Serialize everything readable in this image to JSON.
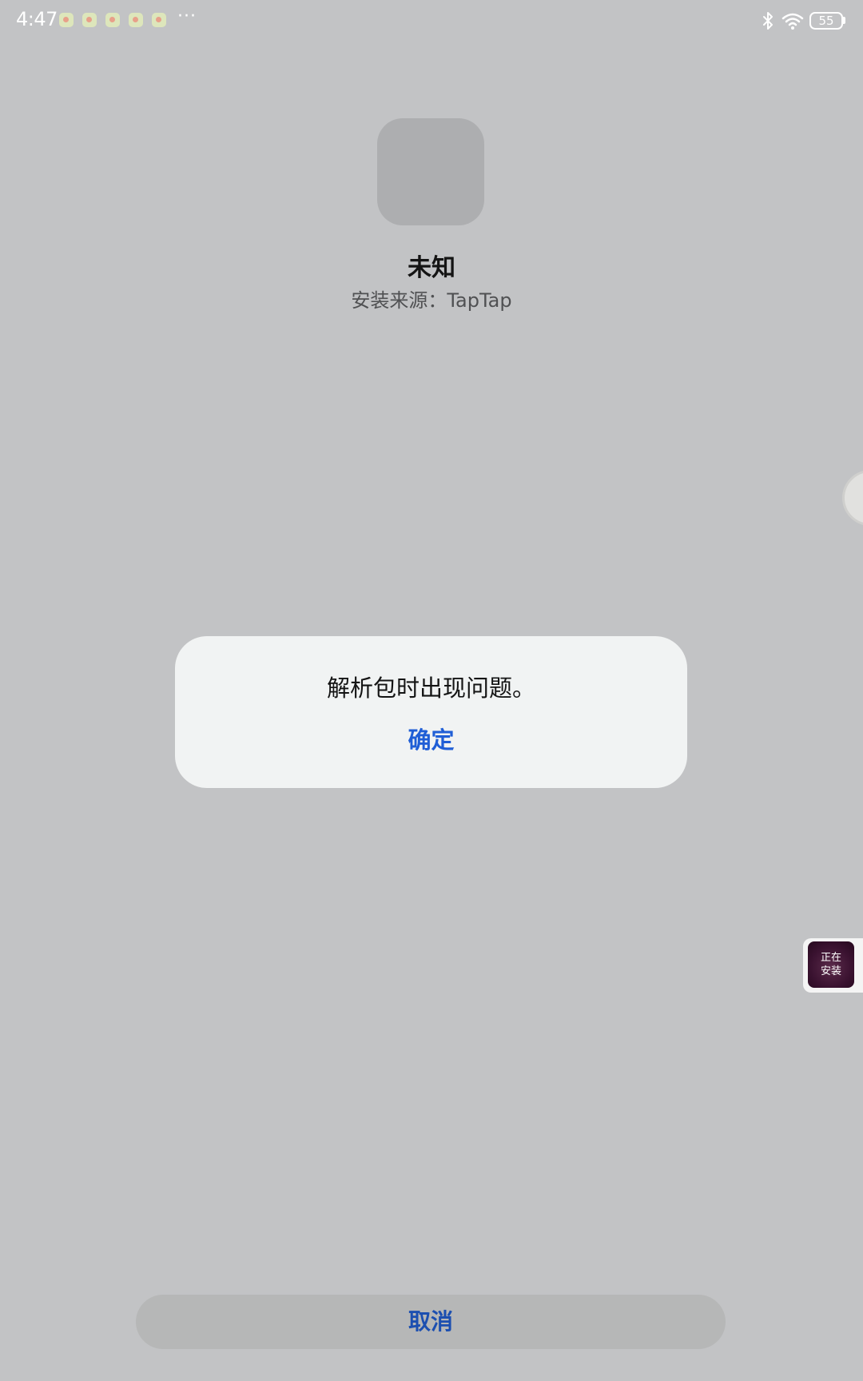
{
  "status_bar": {
    "time": "4:47",
    "notification_icon_count": 5,
    "more_indicator": "···",
    "battery_level": "55",
    "icons": [
      "bluetooth-icon",
      "wifi-icon",
      "battery-icon"
    ]
  },
  "app": {
    "name": "未知",
    "install_source": "安装来源：TapTap"
  },
  "dialog": {
    "message": "解析包时出现问题。",
    "ok_label": "确定"
  },
  "installing_widget": {
    "label": "正在\n安装"
  },
  "footer": {
    "cancel_label": "取消"
  },
  "colors": {
    "background": "#c2c3c5",
    "dialog_bg": "#f1f3f3",
    "accent_blue": "#1f5ed6",
    "cancel_bg": "#b6b7b7"
  }
}
